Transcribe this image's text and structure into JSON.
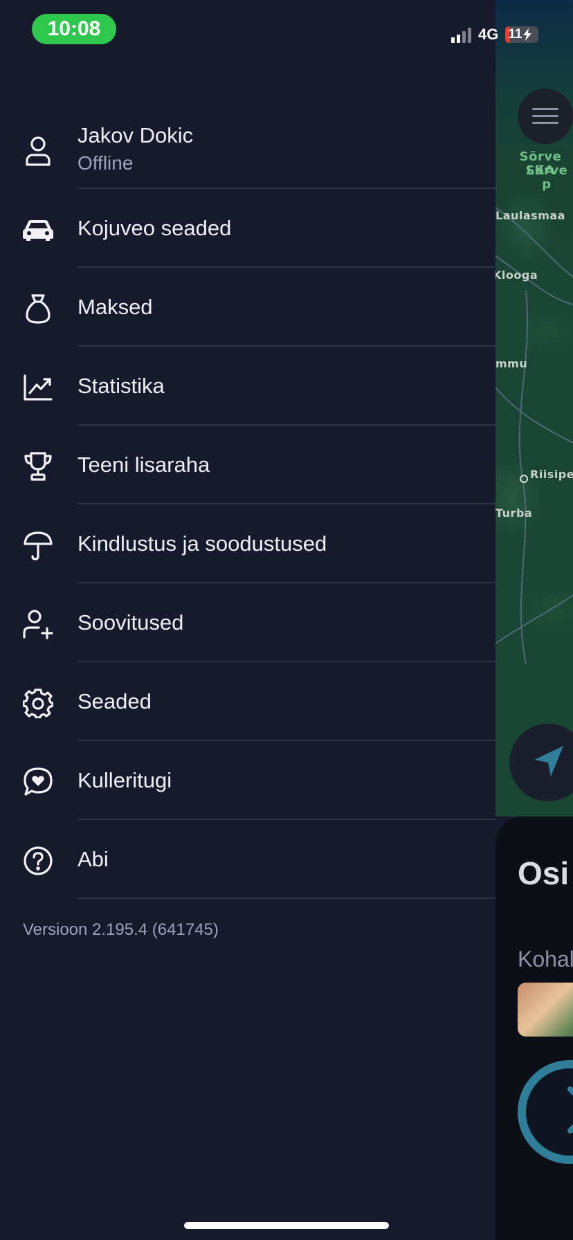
{
  "status_bar": {
    "time": "10:08",
    "network": "4G",
    "battery": "11",
    "battery_level": 0.11
  },
  "drawer": {
    "profile": {
      "name": "Jakov Dokic",
      "status": "Offline",
      "icon": "user-icon"
    },
    "items": [
      {
        "label": "Kojuveo seaded",
        "icon": "car-icon"
      },
      {
        "label": "Maksed",
        "icon": "money-bag-icon"
      },
      {
        "label": "Statistika",
        "icon": "chart-line-icon"
      },
      {
        "label": "Teeni lisaraha",
        "icon": "trophy-icon"
      },
      {
        "label": "Kindlustus ja soodustused",
        "icon": "umbrella-icon"
      },
      {
        "label": "Soovitused",
        "icon": "user-plus-icon"
      },
      {
        "label": "Seaded",
        "icon": "gear-icon"
      },
      {
        "label": "Kulleritugi",
        "icon": "chat-heart-icon"
      },
      {
        "label": "Abi",
        "icon": "help-circle-icon"
      }
    ],
    "version": "Versioon 2.195.4 (641745)"
  },
  "background_app": {
    "map_labels": {
      "sorve_1": "Sõrve LKA",
      "sorve_2": "Sõrve p",
      "laulasmaa": "Laulasmaa",
      "kloogo": "Klooga",
      "ammu": "mmu",
      "riisipere": "Riisipe",
      "turba": "Turba"
    },
    "sheet_title": "Osi",
    "sheet_subtitle": "Kohal"
  },
  "colors": {
    "drawer_bg": "#171a2c",
    "divider": "#2f3347",
    "time_pill": "#2dc84d",
    "secondary_text": "#9fa3ba"
  }
}
